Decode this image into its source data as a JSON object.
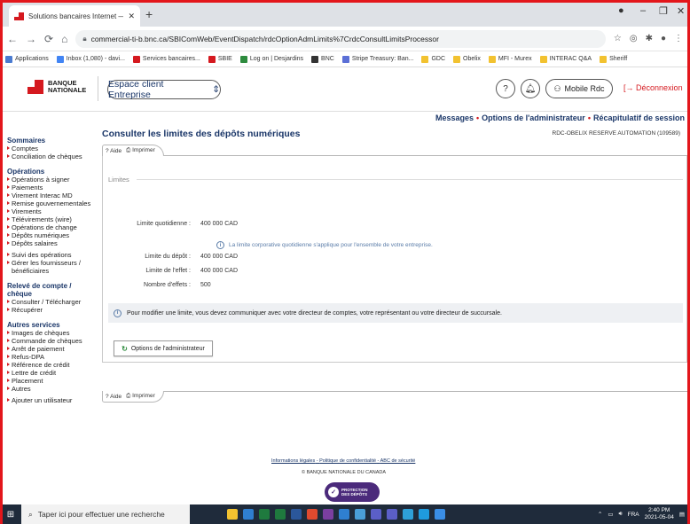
{
  "browser": {
    "tab_title": "Solutions bancaires Internet — I",
    "url": "commercial-ti-b.bnc.ca/SBIComWeb/EventDispatch/rdcOptionAdmLimits%7CrdcConsultLimitsProcessor",
    "bookmarks": [
      {
        "label": "Applications",
        "color": "#4a7bd0"
      },
      {
        "label": "Inbox (1,080) - davi...",
        "color": "#4285f4"
      },
      {
        "label": "Services bancaires...",
        "color": "#d5191f"
      },
      {
        "label": "SBIE",
        "color": "#d5191f"
      },
      {
        "label": "Log on | Desjardins",
        "color": "#2e8b3e"
      },
      {
        "label": "BNC",
        "color": "#333333"
      },
      {
        "label": "Stripe Treasury: Ban...",
        "color": "#5b6fd6"
      },
      {
        "label": "GDC",
        "color": "#f2c230"
      },
      {
        "label": "Obelix",
        "color": "#f2c230"
      },
      {
        "label": "MFI - Murex",
        "color": "#f2c230"
      },
      {
        "label": "INTERAC Q&A",
        "color": "#f2c230"
      },
      {
        "label": "Sheriff",
        "color": "#f2c230"
      }
    ]
  },
  "header": {
    "logo_line1": "BANQUE",
    "logo_line2": "NATIONALE",
    "space_label": "Espace client Entreprise",
    "help_glyph": "?",
    "mobile_label": "Mobile Rdc",
    "logout_label": "Déconnexion"
  },
  "toplinks": {
    "messages": "Messages",
    "admin_options": "Options de l'administrateur",
    "session_summary": "Récapitulatif de session"
  },
  "sidebar": [
    {
      "type": "head",
      "label": "Sommaires"
    },
    {
      "type": "item",
      "label": "Comptes"
    },
    {
      "type": "item",
      "label": "Conciliation de chèques"
    },
    {
      "type": "sep"
    },
    {
      "type": "head",
      "label": "Opérations"
    },
    {
      "type": "item",
      "label": "Opérations à signer"
    },
    {
      "type": "item",
      "label": "Paiements"
    },
    {
      "type": "item",
      "label": "Virement Interac MD"
    },
    {
      "type": "item",
      "label": "Remise gouvernementales"
    },
    {
      "type": "item",
      "label": "Virements"
    },
    {
      "type": "item",
      "label": "Télévirements (wire)"
    },
    {
      "type": "item",
      "label": "Opérations de change"
    },
    {
      "type": "item",
      "label": "Dépôts numériques"
    },
    {
      "type": "item",
      "label": "Dépôts salaires"
    },
    {
      "type": "sep"
    },
    {
      "type": "item",
      "label": "Suivi des opérations"
    },
    {
      "type": "item",
      "label": "Gérer les fournisseurs / bénéficiaires"
    },
    {
      "type": "sep"
    },
    {
      "type": "head",
      "label": "Relevé de compte / chèque"
    },
    {
      "type": "item",
      "label": "Consulter / Télécharger"
    },
    {
      "type": "item",
      "label": "Récupérer"
    },
    {
      "type": "sep"
    },
    {
      "type": "head",
      "label": "Autres services"
    },
    {
      "type": "item",
      "label": "Images de chèques"
    },
    {
      "type": "item",
      "label": "Commande de chèques"
    },
    {
      "type": "item",
      "label": "Arrêt de paiement"
    },
    {
      "type": "item",
      "label": "Refus-DPA"
    },
    {
      "type": "item",
      "label": "Référence de crédit"
    },
    {
      "type": "item",
      "label": "Lettre de crédit"
    },
    {
      "type": "item",
      "label": "Placement"
    },
    {
      "type": "item",
      "label": "Autres"
    },
    {
      "type": "sep"
    },
    {
      "type": "item",
      "label": "Ajouter un utilisateur"
    }
  ],
  "main": {
    "title": "Consulter les limites des dépôts numériques",
    "account_name": "RDC-OBELIX RESERVE AUTOMATION (109589)",
    "help_label": "Aide",
    "print_label": "Imprimer",
    "section_legend": "Limites",
    "daily_limit_label": "Limite quotidienne :",
    "daily_limit_value": "400 000 CAD",
    "daily_limit_note": "La limite corporative quotidienne s'applique pour l'ensemble de votre entreprise.",
    "deposit_limit_label": "Limite du dépôt :",
    "deposit_limit_value": "400 000 CAD",
    "item_limit_label": "Limite de l'effet :",
    "item_limit_value": "400 000 CAD",
    "item_count_label": "Nombre d'effets :",
    "item_count_value": "500",
    "notice": "Pour modifier une limite, vous devez communiquer avec votre directeur de comptes, votre représentant ou votre directeur de succursale.",
    "admin_button": "Options de l'administrateur"
  },
  "footer": {
    "legal": "Informations légales",
    "privacy": "Politique de confidentialité",
    "security": "ABC de sécurité",
    "copyright": "© BANQUE NATIONALE DU CANADA",
    "badge_line1": "PROTECTION",
    "badge_line2": "DES DÉPÔTS"
  },
  "taskbar": {
    "search_placeholder": "Taper ici pour effectuer une recherche",
    "language": "FRA",
    "time": "2:40 PM",
    "date": "2021-05-04"
  }
}
